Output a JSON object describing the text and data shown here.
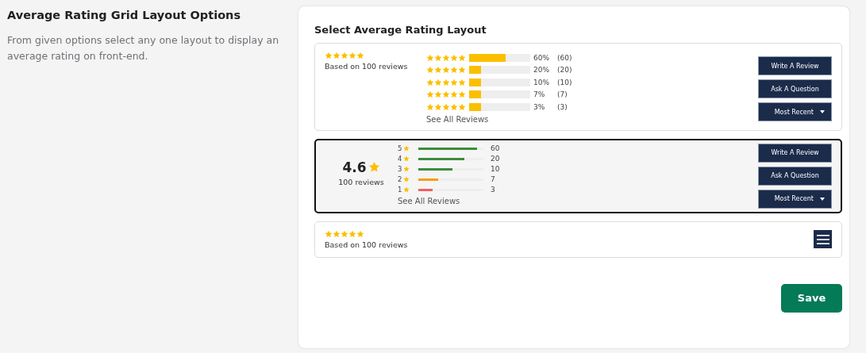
{
  "sidebar": {
    "title": "Average Rating Grid Layout Options",
    "description": "From given options select any one layout to display an average rating on front-end."
  },
  "panel": {
    "title": "Select Average Rating Layout",
    "options": [
      {
        "kind": "stars-bars",
        "selected": false,
        "stars": 5,
        "summary": "Based on 100 reviews",
        "rows": [
          {
            "stars": 5,
            "level": 0.6,
            "percent": "60%",
            "count": "(60)"
          },
          {
            "stars": 5,
            "level": 0.2,
            "percent": "20%",
            "count": "(20)"
          },
          {
            "stars": 5,
            "level": 0.2,
            "percent": "10%",
            "count": "(10)"
          },
          {
            "stars": 5,
            "level": 0.2,
            "percent": "7%",
            "count": "(7)"
          },
          {
            "stars": 5,
            "level": 0.2,
            "percent": "3%",
            "count": "(3)"
          }
        ],
        "link": "See All Reviews",
        "buttons": [
          "Write A Review",
          "Ask A Question"
        ],
        "sort": "Most Recent"
      },
      {
        "kind": "score-bars",
        "selected": true,
        "score": "4.6",
        "summary": "100 reviews",
        "rows": [
          {
            "label": "5",
            "level": 0.9,
            "color": "#3c8c3c",
            "count": "60"
          },
          {
            "label": "4",
            "level": 0.71,
            "color": "#3c8c3c",
            "count": "20"
          },
          {
            "label": "3",
            "level": 0.53,
            "color": "#3c8c3c",
            "count": "10"
          },
          {
            "label": "2",
            "level": 0.31,
            "color": "#f59e0b",
            "count": "7"
          },
          {
            "label": "1",
            "level": 0.22,
            "color": "#f06060",
            "count": "3"
          }
        ],
        "link": "See All Reviews",
        "buttons": [
          "Write A Review",
          "Ask A Question"
        ],
        "sort": "Most Recent"
      },
      {
        "kind": "compact",
        "selected": false,
        "stars": 5,
        "summary": "Based on 100 reviews"
      }
    ],
    "save": "Save"
  }
}
